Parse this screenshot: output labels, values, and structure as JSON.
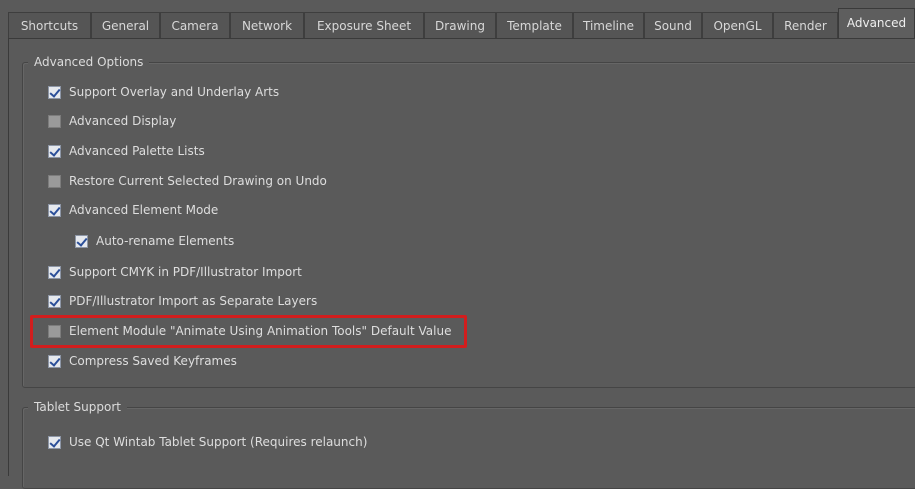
{
  "tabs": [
    {
      "label": "Shortcuts",
      "active": false
    },
    {
      "label": "General",
      "active": false
    },
    {
      "label": "Camera",
      "active": false
    },
    {
      "label": "Network",
      "active": false
    },
    {
      "label": "Exposure Sheet",
      "active": false
    },
    {
      "label": "Drawing",
      "active": false
    },
    {
      "label": "Template",
      "active": false
    },
    {
      "label": "Timeline",
      "active": false
    },
    {
      "label": "Sound",
      "active": false
    },
    {
      "label": "OpenGL",
      "active": false
    },
    {
      "label": "Render",
      "active": false
    },
    {
      "label": "Advanced",
      "active": true
    }
  ],
  "advanced_options": {
    "title": "Advanced Options",
    "options": [
      {
        "label": "Support Overlay and Underlay Arts",
        "checked": true
      },
      {
        "label": "Advanced Display",
        "checked": false
      },
      {
        "label": "Advanced Palette Lists",
        "checked": true
      },
      {
        "label": "Restore Current Selected Drawing on Undo",
        "checked": false
      },
      {
        "label": "Advanced Element Mode",
        "checked": true
      },
      {
        "label": "Auto-rename Elements",
        "checked": true
      },
      {
        "label": "Support CMYK in PDF/Illustrator Import",
        "checked": true
      },
      {
        "label": "PDF/Illustrator Import as Separate Layers",
        "checked": true
      },
      {
        "label": "Element Module \"Animate Using Animation Tools\" Default Value",
        "checked": false
      },
      {
        "label": "Compress Saved Keyframes",
        "checked": true
      }
    ]
  },
  "tablet_support": {
    "title": "Tablet Support",
    "options": [
      {
        "label": "Use Qt Wintab Tablet Support (Requires relaunch)",
        "checked": true
      }
    ]
  },
  "colors": {
    "highlight": "#d21d1d",
    "background": "#5a5a5a"
  }
}
